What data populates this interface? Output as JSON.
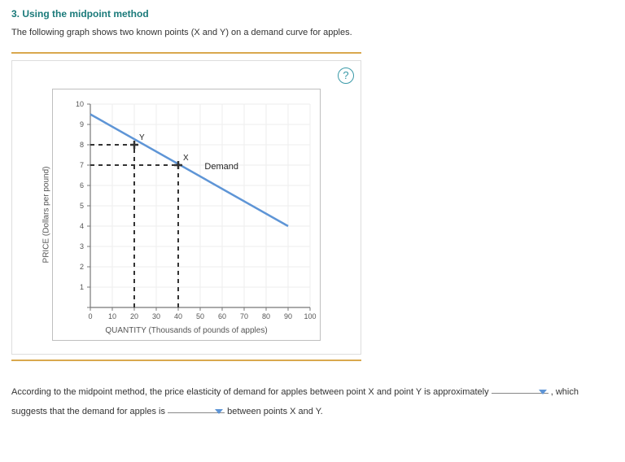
{
  "title": "3. Using the midpoint method",
  "intro": "The following graph shows two known points (X and Y) on a demand curve for apples.",
  "help_tooltip": "?",
  "chart_data": {
    "type": "line",
    "title": "",
    "xlabel": "QUANTITY (Thousands of pounds of apples)",
    "ylabel": "PRICE (Dollars per pound)",
    "xlim": [
      0,
      100
    ],
    "ylim": [
      0,
      10
    ],
    "x_ticks": [
      0,
      10,
      20,
      30,
      40,
      50,
      60,
      70,
      80,
      90,
      100
    ],
    "y_ticks": [
      0,
      1,
      2,
      3,
      4,
      5,
      6,
      7,
      8,
      9,
      10
    ],
    "series": [
      {
        "name": "Demand",
        "x": [
          0,
          90
        ],
        "y": [
          9.5,
          4
        ]
      }
    ],
    "points": [
      {
        "name": "Y",
        "x": 20,
        "y": 8
      },
      {
        "name": "X",
        "x": 40,
        "y": 7
      }
    ],
    "annotations": [
      {
        "text": "Demand",
        "x": 52,
        "y": 6.8
      }
    ]
  },
  "question": {
    "part1": "According to the midpoint method, the price elasticity of demand for apples between point X and point Y is approximately",
    "part2": ", which suggests that",
    "part3": "the demand for apples is",
    "part4": "between points X and Y."
  },
  "dropdowns": {
    "elasticity_value": "",
    "elasticity_type": ""
  }
}
